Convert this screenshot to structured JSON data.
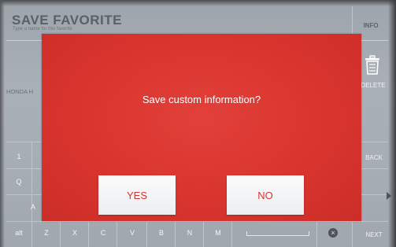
{
  "header": {
    "title": "SAVE FAVORITE",
    "subtitle": "Type a name for this favorite",
    "info_label": "INFO"
  },
  "field": {
    "value": "HONDA H"
  },
  "side_controls": {
    "delete_label": "DELETE",
    "back_label": "BACK",
    "next_label": "NEXT"
  },
  "keyboard": {
    "visible_keys": [
      "1",
      "Q",
      "A"
    ],
    "bottom_row": [
      "alt",
      "Z",
      "X",
      "C",
      "V",
      "B",
      "N",
      "M"
    ]
  },
  "dialog": {
    "message": "Save custom information?",
    "yes_label": "YES",
    "no_label": "NO"
  },
  "colors": {
    "dialog_red": "#d9352f",
    "button_text": "#d7332e",
    "background": "#a6adb5"
  }
}
